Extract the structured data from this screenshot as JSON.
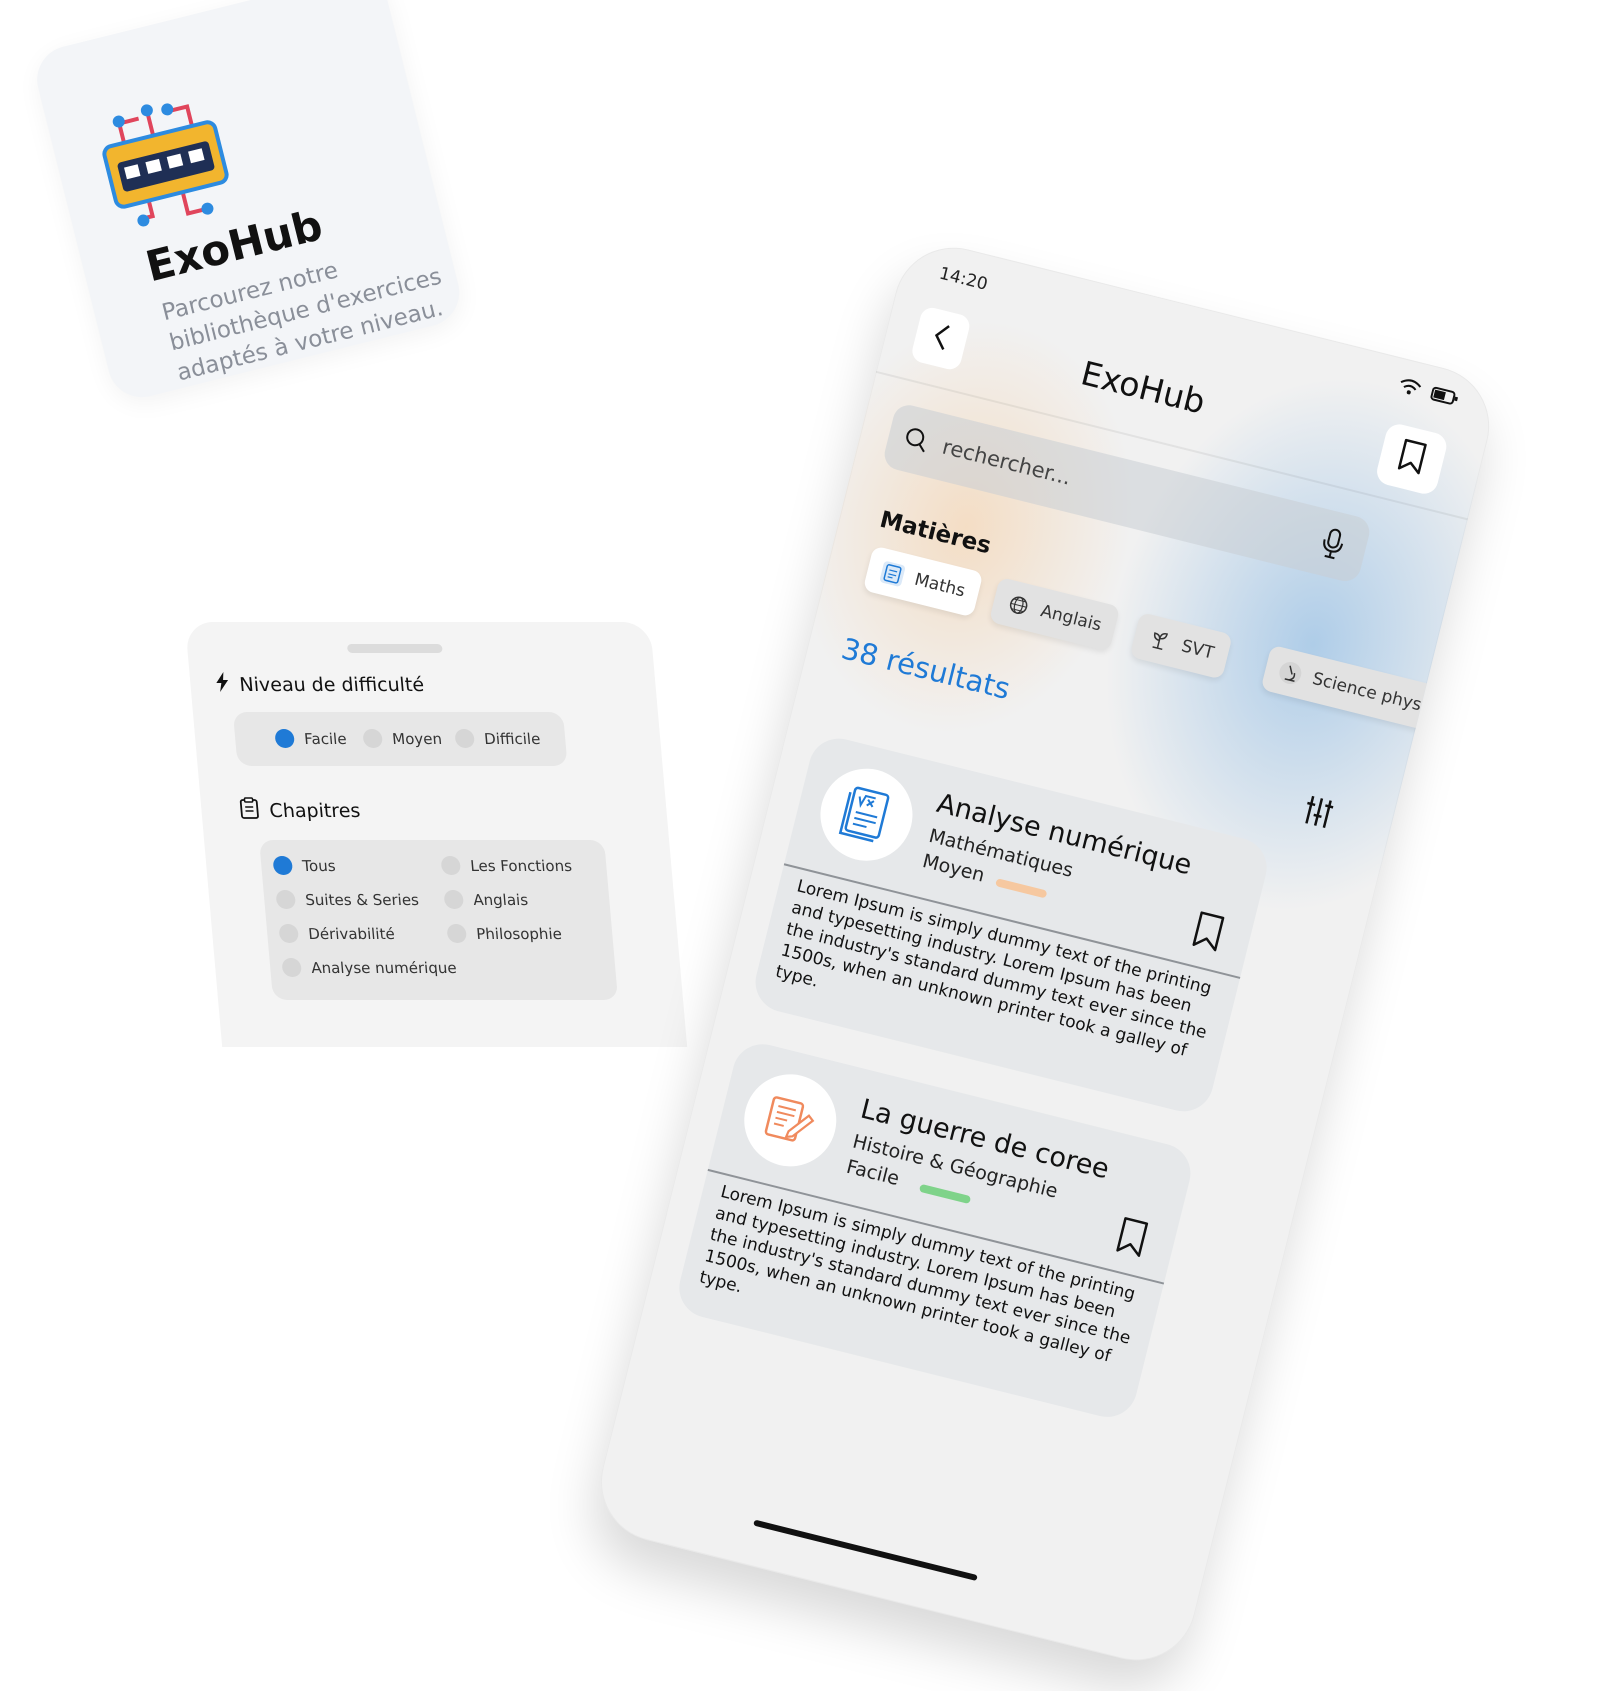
{
  "app_card": {
    "title": "ExoHub",
    "description": "Parcourez notre bibliothèque d'exercices adaptés à votre niveau."
  },
  "filter_panel": {
    "difficulty": {
      "heading": "Niveau de difficulté",
      "options": [
        {
          "label": "Facile",
          "selected": true
        },
        {
          "label": "Moyen",
          "selected": false
        },
        {
          "label": "Difficile",
          "selected": false
        }
      ]
    },
    "chapters": {
      "heading": "Chapitres",
      "options": [
        {
          "label": "Tous",
          "selected": true
        },
        {
          "label": "Les Fonctions",
          "selected": false
        },
        {
          "label": "Suites & Series",
          "selected": false
        },
        {
          "label": "Anglais",
          "selected": false
        },
        {
          "label": "Dérivabilité",
          "selected": false
        },
        {
          "label": "Philosophie",
          "selected": false
        },
        {
          "label": "Analyse numérique",
          "selected": false
        }
      ]
    }
  },
  "phone": {
    "status": {
      "time": "14:20"
    },
    "header": {
      "title": "ExoHub"
    },
    "search": {
      "placeholder": "rechercher..."
    },
    "subjects": {
      "heading": "Matières",
      "chips": [
        {
          "label": "Maths",
          "icon": "math-book-icon",
          "active": true
        },
        {
          "label": "Anglais",
          "icon": "globe-icon",
          "active": false
        },
        {
          "label": "SVT",
          "icon": "plant-icon",
          "active": false
        },
        {
          "label": "Science physique",
          "icon": "microscope-icon",
          "active": false
        }
      ]
    },
    "results_label": "38 résultats",
    "cards": [
      {
        "title": "Analyse numérique",
        "subject": "Mathématiques",
        "level": "Moyen",
        "level_color": "#f6c8a0",
        "icon": "math-document-icon",
        "body": "Lorem Ipsum is simply dummy text of the printing and typesetting industry. Lorem Ipsum has been the industry's standard dummy  text ever since the 1500s, when an unknown printer took a galley of  type."
      },
      {
        "title": "La guerre de coree",
        "subject": "Histoire & Géographie",
        "level": "Facile",
        "level_color": "#7fd38a",
        "icon": "writing-icon",
        "body": "Lorem Ipsum is simply dummy text of the printing and typesetting industry. Lorem Ipsum has been the industry's standard dummy  text ever since the 1500s, when an unknown printer took a galley of  type."
      }
    ]
  },
  "colors": {
    "accent": "#1f7ad6",
    "card_background": "#e6e8ea",
    "panel_background": "#f4f4f4"
  }
}
